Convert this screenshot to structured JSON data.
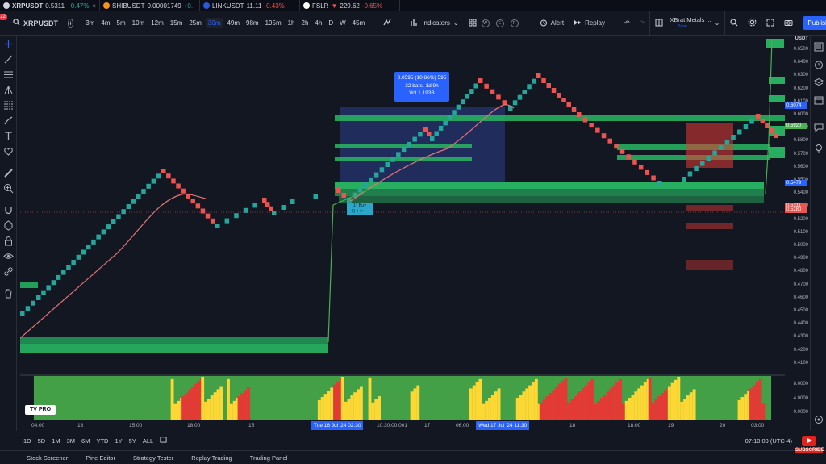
{
  "tickers": [
    {
      "symbol": "XRPUSDT",
      "price": "0.5311",
      "change": "+0.47%",
      "dir": "up",
      "color": "#d1d4dc"
    },
    {
      "symbol": "SHIBUSDT",
      "price": "0.00001749",
      "change": "+0.",
      "dir": "up",
      "color": "#f7931a"
    },
    {
      "symbol": "LINKUSDT",
      "price": "11.11",
      "change": "-0.43%",
      "dir": "dn",
      "color": "#2a5ada"
    },
    {
      "symbol": "FSLR",
      "price": "229.62",
      "change": "-0.65%",
      "dir": "dn",
      "color": "#ffffff"
    }
  ],
  "toolbar": {
    "avatar_badge": "22",
    "symbol": "XRPUSDT",
    "add_symbol": "+",
    "timeframes": [
      "3m",
      "4m",
      "5m",
      "10m",
      "12m",
      "15m",
      "25m",
      "30m",
      "49m",
      "98m",
      "195m",
      "1h",
      "2h",
      "4h",
      "D",
      "W",
      "45m"
    ],
    "active_timeframe": "30m",
    "indicators_label": "Indicators",
    "template_icons": [
      "W",
      "E",
      "R"
    ],
    "alert_label": "Alert",
    "replay_label": "Replay",
    "layout_name": "XBrat Metals ...",
    "layout_sub": "Save",
    "publish_label": "Publish"
  },
  "price_axis": {
    "currency": "USDT",
    "labels": [
      "0.6500",
      "0.6400",
      "0.6300",
      "0.6200",
      "0.6100",
      "0.6000",
      "0.5900",
      "0.5800",
      "0.5700",
      "0.5600",
      "0.5500",
      "0.5400",
      "0.5300",
      "0.5200",
      "0.5100",
      "0.5000",
      "0.4900",
      "0.4800",
      "0.4700",
      "0.4600",
      "0.4500",
      "0.4400",
      "0.4300",
      "0.4200",
      "0.4100"
    ],
    "tags": [
      {
        "value": "0.6074",
        "color": "#2962ff"
      },
      {
        "value": "0.5920",
        "color": "#4caf50"
      },
      {
        "value": "0.5479",
        "color": "#2962ff"
      },
      {
        "value": "0.5311",
        "color": "#ef5350"
      },
      {
        "value": "0.5280",
        "color": "#ef5350"
      }
    ]
  },
  "tooltip": {
    "line1": "0.0595 (10.86%) 595",
    "line2": "32 bars, 1d 9h",
    "line3": "Vol 1.193B"
  },
  "buy_flag": {
    "line1": "1) Buy",
    "line2": "1) +++ --"
  },
  "oscillator_axis": [
    "8.0000",
    "4.0000",
    "0.0000"
  ],
  "logo_text": "TV PRO",
  "time_axis": {
    "labels": [
      "04:00",
      "13",
      "15:00",
      "18:00",
      "15",
      "17",
      "06:00",
      "18",
      "18:00",
      "19",
      "20",
      "03:00"
    ],
    "highlight_1": "Tue 16 Jul '24   02:30",
    "highlight_2": "Wed 17 Jul '24   11:30",
    "range_label": "10:30:00.001"
  },
  "range_buttons": [
    "1D",
    "5D",
    "1M",
    "3M",
    "6M",
    "YTD",
    "1Y",
    "5Y",
    "ALL"
  ],
  "clock": "07:10:09 (UTC-4)",
  "bottom_tabs": [
    "Stock Screener",
    "Pine Editor",
    "Strategy Tester",
    "Replay Trading",
    "Trading Panel"
  ],
  "subscribe_label": "SUBSCRIBE",
  "colors": {
    "bull": "#26a69a",
    "bear": "#ef5350",
    "zone_green": "#27ae60",
    "zone_red": "#e53935",
    "accent": "#2962ff"
  }
}
